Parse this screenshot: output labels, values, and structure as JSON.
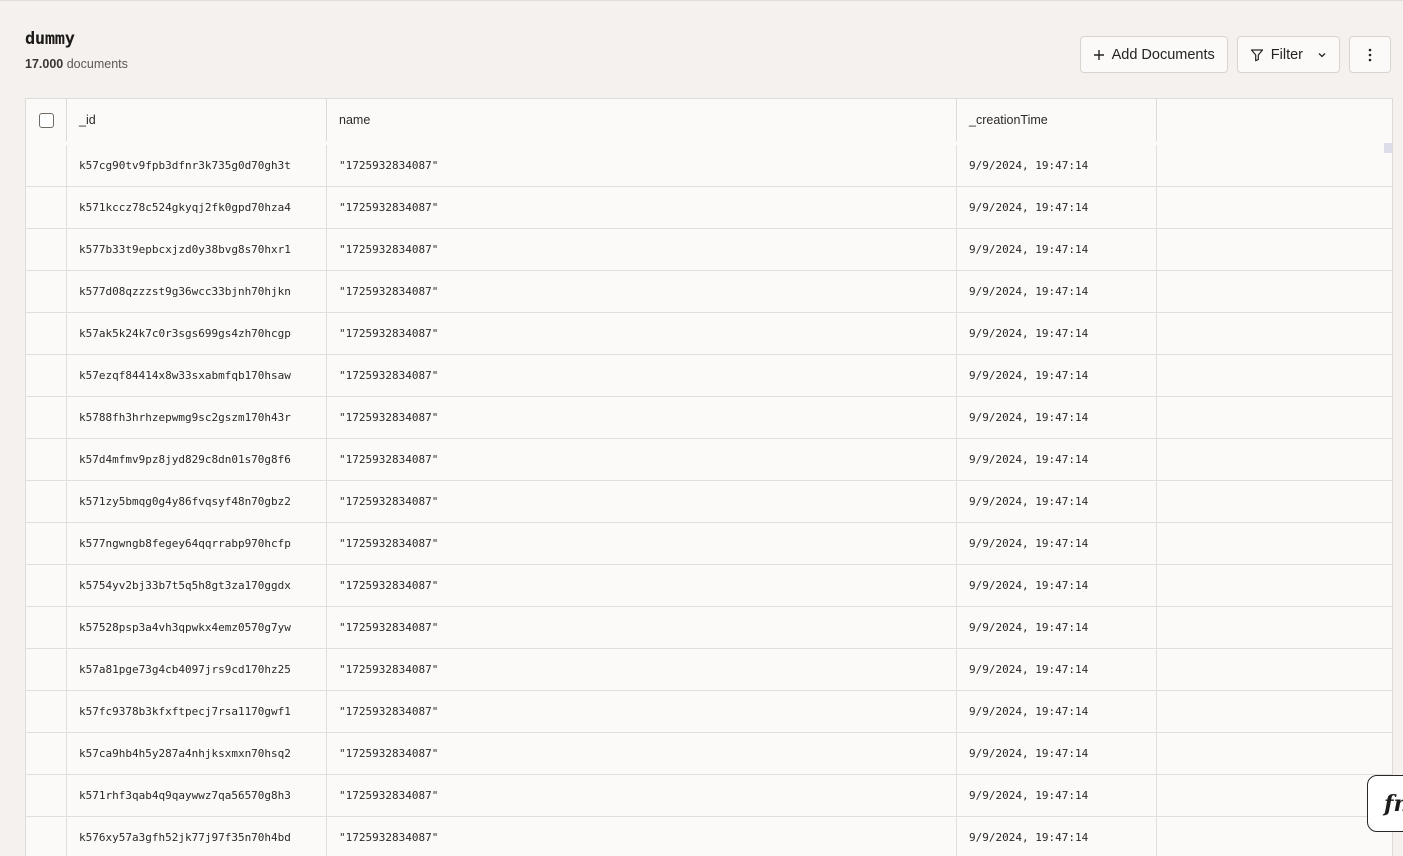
{
  "table": {
    "name": "dummy",
    "count": "17.000",
    "count_suffix": "documents"
  },
  "toolbar": {
    "add_label": "Add Documents",
    "filter_label": "Filter"
  },
  "columns": [
    "_id",
    "name",
    "_creationTime",
    ""
  ],
  "rows": [
    {
      "id": "k57cg90tv9fpb3dfnr3k735g0d70gh3t",
      "name": "\"1725932834087\"",
      "time": "9/9/2024, 19:47:14"
    },
    {
      "id": "k571kccz78c524gkyqj2fk0gpd70hza4",
      "name": "\"1725932834087\"",
      "time": "9/9/2024, 19:47:14"
    },
    {
      "id": "k577b33t9epbcxjzd0y38bvg8s70hxr1",
      "name": "\"1725932834087\"",
      "time": "9/9/2024, 19:47:14"
    },
    {
      "id": "k577d08qzzzst9g36wcc33bjnh70hjkn",
      "name": "\"1725932834087\"",
      "time": "9/9/2024, 19:47:14"
    },
    {
      "id": "k57ak5k24k7c0r3sgs699gs4zh70hcgp",
      "name": "\"1725932834087\"",
      "time": "9/9/2024, 19:47:14"
    },
    {
      "id": "k57ezqf84414x8w33sxabmfqb170hsaw",
      "name": "\"1725932834087\"",
      "time": "9/9/2024, 19:47:14"
    },
    {
      "id": "k5788fh3hrhzepwmg9sc2gszm170h43r",
      "name": "\"1725932834087\"",
      "time": "9/9/2024, 19:47:14"
    },
    {
      "id": "k57d4mfmv9pz8jyd829c8dn01s70g8f6",
      "name": "\"1725932834087\"",
      "time": "9/9/2024, 19:47:14"
    },
    {
      "id": "k571zy5bmqg0g4y86fvqsyf48n70gbz2",
      "name": "\"1725932834087\"",
      "time": "9/9/2024, 19:47:14"
    },
    {
      "id": "k577ngwngb8fegey64qqrrabp970hcfp",
      "name": "\"1725932834087\"",
      "time": "9/9/2024, 19:47:14"
    },
    {
      "id": "k5754yv2bj33b7t5q5h8gt3za170ggdx",
      "name": "\"1725932834087\"",
      "time": "9/9/2024, 19:47:14"
    },
    {
      "id": "k57528psp3a4vh3qpwkx4emz0570g7yw",
      "name": "\"1725932834087\"",
      "time": "9/9/2024, 19:47:14"
    },
    {
      "id": "k57a81pge73g4cb4097jrs9cd170hz25",
      "name": "\"1725932834087\"",
      "time": "9/9/2024, 19:47:14"
    },
    {
      "id": "k57fc9378b3kfxftpecj7rsa1170gwf1",
      "name": "\"1725932834087\"",
      "time": "9/9/2024, 19:47:14"
    },
    {
      "id": "k57ca9hb4h5y287a4nhjksxmxn70hsq2",
      "name": "\"1725932834087\"",
      "time": "9/9/2024, 19:47:14"
    },
    {
      "id": "k571rhf3qab4q9qaywwz7qa56570g8h3",
      "name": "\"1725932834087\"",
      "time": "9/9/2024, 19:47:14"
    },
    {
      "id": "k576xy57a3gfh52jk77j97f35n70h4bd",
      "name": "\"1725932834087\"",
      "time": "9/9/2024, 19:47:14"
    }
  ],
  "fn_button": {
    "label": "fn"
  },
  "icons": {
    "add": "plus-icon",
    "filter": "funnel-icon",
    "chevron": "chevron-down-icon",
    "more": "kebab-menu-icon"
  }
}
